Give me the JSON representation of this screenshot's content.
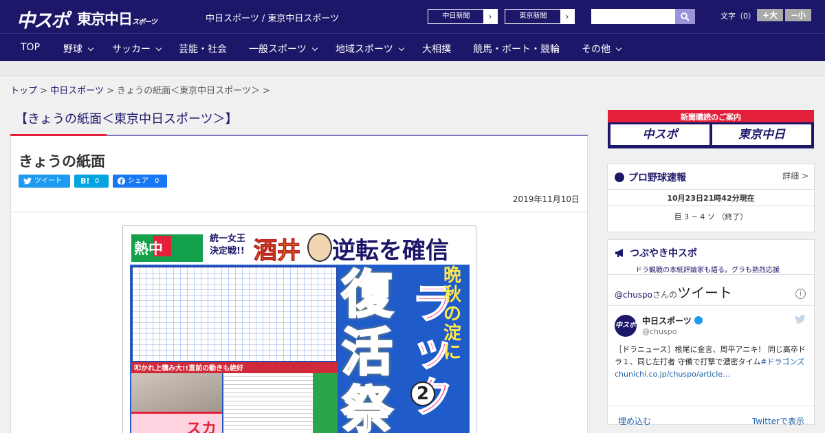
{
  "header": {
    "logo_chuspo": "中スポ",
    "logo_tokyo": "東京中日",
    "logo_tokyo_sub": "スポーツ",
    "site_name": "中日スポーツ / 東京中日スポーツ",
    "link_chunichi": "中日新聞",
    "link_tokyo": "東京新聞",
    "search_placeholder": "",
    "font_label": "文字（0）",
    "font_larger": "+大",
    "font_smaller": "−小"
  },
  "nav": [
    {
      "label": "TOP",
      "dropdown": false
    },
    {
      "label": "野球",
      "dropdown": true
    },
    {
      "label": "サッカー",
      "dropdown": true
    },
    {
      "label": "芸能・社会",
      "dropdown": false
    },
    {
      "label": "一般スポーツ",
      "dropdown": true
    },
    {
      "label": "地域スポーツ",
      "dropdown": true
    },
    {
      "label": "大相撲",
      "dropdown": false
    },
    {
      "label": "競馬・ボート・競輪",
      "dropdown": false
    },
    {
      "label": "その他",
      "dropdown": true
    }
  ],
  "breadcrumb": {
    "top": "トップ",
    "sep1": " > ",
    "chunichi": "中日スポーツ",
    "sep2": " > ",
    "current": "きょうの紙面＜東京中日スポーツ＞ >"
  },
  "page_title": "【きょうの紙面＜東京中日スポーツ＞】",
  "article": {
    "heading": "きょうの紙面",
    "tweet_label": "ツイート",
    "hatena_label": "B!",
    "hatena_count": "0",
    "facebook_label": "シェア",
    "facebook_count": "0",
    "date": "2019年11月10日"
  },
  "newspaper": {
    "logo": "熱中",
    "headline_small": "統一女王\n決定戦!!",
    "headline_name": "酒井",
    "headline_main": "逆転を確信",
    "mid_strip": "叩かれ上積み大!!直前の動きも絶好",
    "big_vertical": "復活祭",
    "pink_vertical": "ラック",
    "yellow_vertical": "晩秋の淀に",
    "corner_word": "スカ",
    "circle_number": "2"
  },
  "sidebar": {
    "subscribe_title": "新聞購読のご案内",
    "subscribe_chuspo": "中スポ",
    "subscribe_tokyo": "東京中日",
    "baseball": {
      "title": "プロ野球速報",
      "detail": "詳細 >",
      "date": "10月23日21時42分現在",
      "score": "巨 3 − 4 ソ （終了）"
    },
    "tsubuyaki": {
      "title": "つぶやき中スポ",
      "subtitle": "ドラ観戦の本紙評論家も語る。グラも熱烈応援",
      "widget_handle": "@chuspo",
      "widget_san": "さんの",
      "widget_title": "ツイート",
      "account_name": "中日スポーツ",
      "account_handle": "@chuspo",
      "avatar_text": "中スポ",
      "tweet_text": "［ドラニュース］根尾に金言、周平アニキ！ 同じ高卒ドラ１、同じ左打者 守備で打撃で濃密タイム",
      "tweet_hashtag": "#ドラゴンズ",
      "tweet_link": "chunichi.co.jp/chuspo/article…",
      "embed_label": "埋め込む",
      "view_on_twitter": "Twitterで表示"
    }
  },
  "colors": {
    "brand_navy": "#1c1769",
    "accent_red": "#e41f3a",
    "accent_purple": "#7c75b8"
  }
}
